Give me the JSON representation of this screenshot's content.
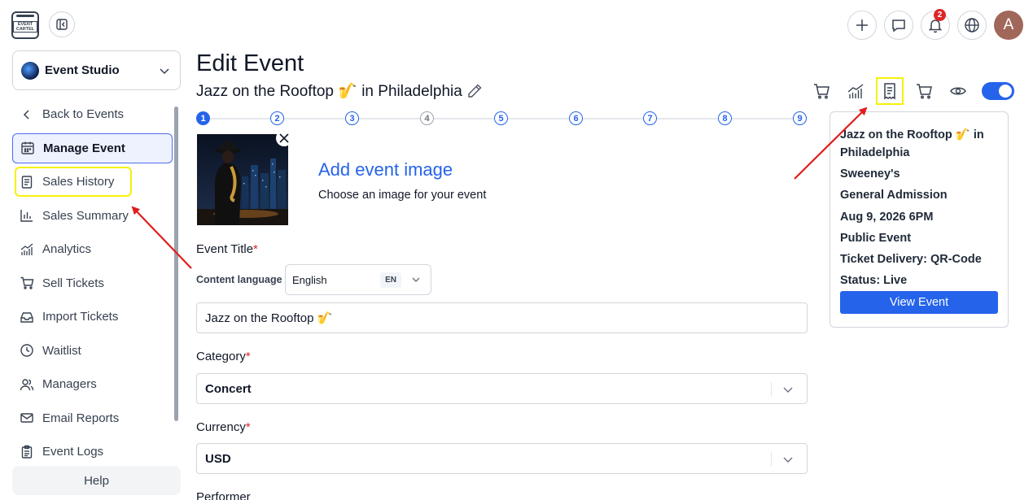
{
  "app": {
    "logo_text": "EVENT CARTEL"
  },
  "topbar": {
    "notification_count": "2",
    "avatar_initial": "A"
  },
  "sidebar": {
    "studio_name": "Event Studio",
    "items": [
      {
        "label": "Back to Events",
        "icon": "chevron-left-icon"
      },
      {
        "label": "Manage Event",
        "icon": "calendar-icon",
        "active": true
      },
      {
        "label": "Sales History",
        "icon": "receipt-icon"
      },
      {
        "label": "Sales Summary",
        "icon": "bar-chart-icon"
      },
      {
        "label": "Analytics",
        "icon": "trend-chart-icon"
      },
      {
        "label": "Sell Tickets",
        "icon": "cart-icon"
      },
      {
        "label": "Import Tickets",
        "icon": "inbox-icon"
      },
      {
        "label": "Waitlist",
        "icon": "clock-icon"
      },
      {
        "label": "Managers",
        "icon": "users-icon"
      },
      {
        "label": "Email Reports",
        "icon": "mail-icon"
      },
      {
        "label": "Event Logs",
        "icon": "clipboard-icon"
      }
    ],
    "help_label": "Help"
  },
  "main": {
    "page_title": "Edit Event",
    "subtitle": "Jazz on the Rooftop 🎷 in Philadelphia",
    "steps": [
      "1",
      "2",
      "3",
      "4",
      "5",
      "6",
      "7",
      "8",
      "9"
    ],
    "image": {
      "add_label": "Add event image",
      "hint": "Choose an image for your event"
    },
    "event_title_label": "Event Title",
    "required_mark": "*",
    "content_language_label": "Content language",
    "content_language_value": "English",
    "content_language_code": "EN",
    "event_title_value": "Jazz on the Rooftop 🎷",
    "category_label": "Category",
    "category_value": "Concert",
    "currency_label": "Currency",
    "currency_value": "USD",
    "performer_label": "Performer"
  },
  "summary": {
    "title": "Jazz on the Rooftop 🎷 in Philadelphia",
    "venue": "Sweeney's",
    "admission": "General Admission",
    "datetime": "Aug 9, 2026 6PM",
    "visibility": "Public Event",
    "delivery": "Ticket Delivery: QR-Code",
    "status": "Status: Live",
    "view_button": "View Event"
  },
  "colors": {
    "accent": "#2563eb",
    "highlight": "#f5f10a",
    "arrow": "#e11d1d",
    "required": "#dc2626"
  }
}
